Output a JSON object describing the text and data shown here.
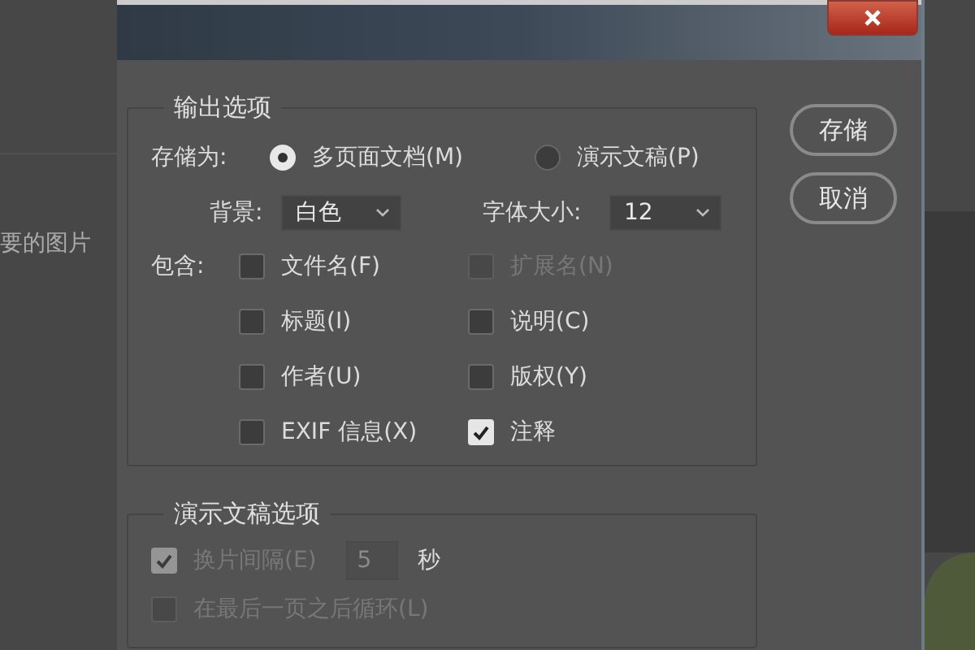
{
  "background_text": "要的图片",
  "dialog": {
    "output_options": {
      "title": "输出选项",
      "save_as": {
        "label": "存储为:",
        "options": [
          {
            "label": "多页面文档(M)",
            "selected": true
          },
          {
            "label": "演示文稿(P)",
            "selected": false
          }
        ]
      },
      "background": {
        "label": "背景:",
        "value": "白色"
      },
      "font_size": {
        "label": "字体大小:",
        "value": "12"
      },
      "include": {
        "label": "包含:",
        "items": [
          {
            "label": "文件名(F)",
            "checked": false,
            "disabled": false
          },
          {
            "label": "扩展名(N)",
            "checked": false,
            "disabled": true
          },
          {
            "label": "标题(I)",
            "checked": false,
            "disabled": false
          },
          {
            "label": "说明(C)",
            "checked": false,
            "disabled": false
          },
          {
            "label": "作者(U)",
            "checked": false,
            "disabled": false
          },
          {
            "label": "版权(Y)",
            "checked": false,
            "disabled": false
          },
          {
            "label": "EXIF 信息(X)",
            "checked": false,
            "disabled": false
          },
          {
            "label": "注释",
            "checked": true,
            "disabled": false
          }
        ]
      }
    },
    "presentation_options": {
      "title": "演示文稿选项",
      "items": [
        {
          "kind": "interval",
          "label": "换片间隔(E)",
          "checked": true,
          "disabled": true,
          "value": "5",
          "unit": "秒"
        },
        {
          "kind": "loop",
          "label": "在最后一页之后循环(L)",
          "checked": false,
          "disabled": true
        }
      ]
    },
    "buttons": [
      {
        "label": "存储"
      },
      {
        "label": "取消"
      }
    ]
  }
}
